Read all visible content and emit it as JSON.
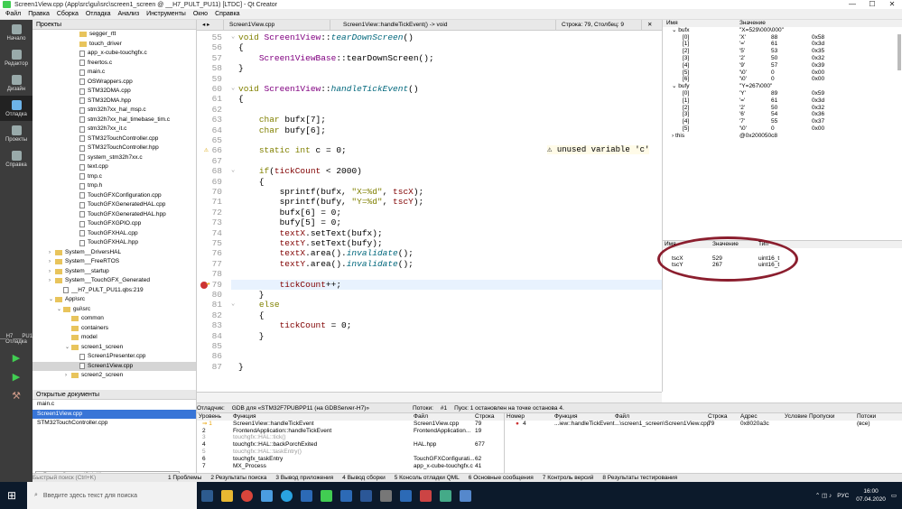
{
  "window": {
    "title": "Screen1View.cpp (App\\src\\gui\\src\\screen1_screen @ __H7_PULT_PU11) [LTDC] - Qt Creator",
    "controls": [
      "—",
      "☐",
      "✕"
    ]
  },
  "menu": [
    "Файл",
    "Правка",
    "Сборка",
    "Отладка",
    "Анализ",
    "Инструменты",
    "Окно",
    "Справка"
  ],
  "modes": [
    {
      "label": "Начало",
      "icon": "grid-icon"
    },
    {
      "label": "Редактор",
      "icon": "document-icon"
    },
    {
      "label": "Дизайн",
      "icon": "pencil-icon"
    },
    {
      "label": "Отладка",
      "icon": "bug-icon"
    },
    {
      "label": "Проекты",
      "icon": "wrench-icon"
    },
    {
      "label": "Справка",
      "icon": "help-icon"
    }
  ],
  "mode_kit": "__H7___PU11",
  "mode_kit2": "Отладка",
  "project": {
    "header": "Проекты",
    "items": [
      {
        "t": "segger_rtt",
        "k": "fo",
        "d": 5
      },
      {
        "t": "touch_driver",
        "k": "fo",
        "d": 5
      },
      {
        "t": "app_x-cube-touchgfx.c",
        "k": "fi",
        "d": 5
      },
      {
        "t": "freertos.c",
        "k": "fi",
        "d": 5
      },
      {
        "t": "main.c",
        "k": "fi",
        "d": 5
      },
      {
        "t": "OSWrappers.cpp",
        "k": "fi",
        "d": 5
      },
      {
        "t": "STM32DMA.cpp",
        "k": "fi",
        "d": 5
      },
      {
        "t": "STM32DMA.hpp",
        "k": "fi",
        "d": 5
      },
      {
        "t": "stm32h7xx_hal_msp.c",
        "k": "fi",
        "d": 5
      },
      {
        "t": "stm32h7xx_hal_timebase_tim.c",
        "k": "fi",
        "d": 5
      },
      {
        "t": "stm32h7xx_it.c",
        "k": "fi",
        "d": 5
      },
      {
        "t": "STM32TouchController.cpp",
        "k": "fi",
        "d": 5
      },
      {
        "t": "STM32TouchController.hpp",
        "k": "fi",
        "d": 5
      },
      {
        "t": "system_stm32h7xx.c",
        "k": "fi",
        "d": 5
      },
      {
        "t": "text.cpp",
        "k": "fi",
        "d": 5
      },
      {
        "t": "tmp.c",
        "k": "fi",
        "d": 5
      },
      {
        "t": "tmp.h",
        "k": "fi",
        "d": 5
      },
      {
        "t": "TouchGFXConfiguration.cpp",
        "k": "fi",
        "d": 5
      },
      {
        "t": "TouchGFXGeneratedHAL.cpp",
        "k": "fi",
        "d": 5
      },
      {
        "t": "TouchGFXGeneratedHAL.hpp",
        "k": "fi",
        "d": 5
      },
      {
        "t": "TouchGFXGPIO.cpp",
        "k": "fi",
        "d": 5
      },
      {
        "t": "TouchGFXHAL.cpp",
        "k": "fi",
        "d": 5
      },
      {
        "t": "TouchGFXHAL.hpp",
        "k": "fi",
        "d": 5
      },
      {
        "t": "System__DriversHAL",
        "k": "fo",
        "d": 2,
        "a": "›"
      },
      {
        "t": "System__FreeRTOS",
        "k": "fo",
        "d": 2,
        "a": "›"
      },
      {
        "t": "System__startup",
        "k": "fo",
        "d": 2,
        "a": "›"
      },
      {
        "t": "System__TouchGFX_Generated",
        "k": "fo",
        "d": 2,
        "a": "›"
      },
      {
        "t": "__H7_PULT_PU11.qbs:219",
        "k": "fi",
        "d": 3
      },
      {
        "t": "App\\src",
        "k": "fo",
        "d": 2,
        "a": "⌄"
      },
      {
        "t": "gui\\src",
        "k": "fo",
        "d": 3,
        "a": "⌄"
      },
      {
        "t": "common",
        "k": "fo",
        "d": 4
      },
      {
        "t": "containers",
        "k": "fo",
        "d": 4
      },
      {
        "t": "model",
        "k": "fo",
        "d": 4
      },
      {
        "t": "screen1_screen",
        "k": "fo",
        "d": 4,
        "a": "⌄"
      },
      {
        "t": "Screen1Presenter.cpp",
        "k": "fi",
        "d": 5
      },
      {
        "t": "Screen1View.cpp",
        "k": "fi",
        "d": 5,
        "sel": true
      },
      {
        "t": "screen2_screen",
        "k": "fo",
        "d": 4,
        "a": "›"
      }
    ]
  },
  "open_docs": {
    "header": "Открытые документы",
    "items": [
      "main.c",
      "Screen1View.cpp",
      "STM32TouchController.cpp"
    ],
    "selected": 1
  },
  "editor": {
    "file": "Screen1View.cpp",
    "symbol": "Screen1View::handleTickEvent() -> void",
    "position": "Строка: 79, Столбец: 9",
    "lines": [
      {
        "n": "55",
        "h": "<span class=\"kw\">void</span> <span class=\"cls\">Screen1View</span>::<span class=\"fn\">tearDownScreen</span>()"
      },
      {
        "n": "56",
        "h": "{"
      },
      {
        "n": "57",
        "h": "    <span class=\"cls\">Screen1ViewBase</span>::tearDownScreen();"
      },
      {
        "n": "58",
        "h": "}"
      },
      {
        "n": "59",
        "h": ""
      },
      {
        "n": "60",
        "h": "<span class=\"kw\">void</span> <span class=\"cls\">Screen1View</span>::<span class=\"fn\">handleTickEvent</span>()"
      },
      {
        "n": "61",
        "h": "{"
      },
      {
        "n": "62",
        "h": ""
      },
      {
        "n": "63",
        "h": "    <span class=\"kw\">char</span> bufx[7];"
      },
      {
        "n": "64",
        "h": "    <span class=\"kw\">char</span> bufy[6];"
      },
      {
        "n": "65",
        "h": ""
      },
      {
        "n": "66",
        "h": "    <span class=\"kw\">static</span> <span class=\"kw\">int</span> c = 0;"
      },
      {
        "n": "67",
        "h": ""
      },
      {
        "n": "68",
        "h": "    <span class=\"kw\">if</span>(<span class=\"mm\">tickCount</span> &lt; 2000)"
      },
      {
        "n": "69",
        "h": "    {"
      },
      {
        "n": "70",
        "h": "        sprintf(bufx, <span class=\"kw\">\"X=%d\"</span>, <span class=\"mm\">tscX</span>);"
      },
      {
        "n": "71",
        "h": "        sprintf(bufy, <span class=\"kw\">\"Y=%d\"</span>, <span class=\"mm\">tscY</span>);"
      },
      {
        "n": "72",
        "h": "        bufx[6] = 0;"
      },
      {
        "n": "73",
        "h": "        bufy[5] = 0;"
      },
      {
        "n": "74",
        "h": "        <span class=\"mm\">textX</span>.setText(bufx);"
      },
      {
        "n": "75",
        "h": "        <span class=\"mm\">textY</span>.setText(bufy);"
      },
      {
        "n": "76",
        "h": "        <span class=\"mm\">textX</span>.area().<span class=\"fn\">invalidate</span>();"
      },
      {
        "n": "77",
        "h": "        <span class=\"mm\">textY</span>.area().<span class=\"fn\">invalidate</span>();"
      },
      {
        "n": "78",
        "h": ""
      },
      {
        "n": "79",
        "h": "        <span class=\"mm\">tickCount</span>++;"
      },
      {
        "n": "80",
        "h": "    }"
      },
      {
        "n": "81",
        "h": "    <span class=\"kw\">else</span>"
      },
      {
        "n": "82",
        "h": "    {"
      },
      {
        "n": "83",
        "h": "        <span class=\"mm\">tickCount</span> = 0;"
      },
      {
        "n": "84",
        "h": "    }"
      },
      {
        "n": "85",
        "h": ""
      },
      {
        "n": "86",
        "h": ""
      },
      {
        "n": "87",
        "h": "}"
      }
    ],
    "warning": "⚠ unused variable 'c'",
    "warning_line": "66",
    "current_line": "79"
  },
  "watch": {
    "headers": [
      "Имя",
      "Значение"
    ],
    "rows": [
      {
        "i": 0,
        "n": "⌄ bufx",
        "v": "\"X=529\\000\\000\"",
        "h": ""
      },
      {
        "i": 1,
        "n": "[0]",
        "v": "'X'",
        "d": "88",
        "h": "0x58"
      },
      {
        "i": 1,
        "n": "[1]",
        "v": "'='",
        "d": "61",
        "h": "0x3d"
      },
      {
        "i": 1,
        "n": "[2]",
        "v": "'5'",
        "d": "53",
        "h": "0x35"
      },
      {
        "i": 1,
        "n": "[3]",
        "v": "'2'",
        "d": "50",
        "h": "0x32"
      },
      {
        "i": 1,
        "n": "[4]",
        "v": "'9'",
        "d": "57",
        "h": "0x39"
      },
      {
        "i": 1,
        "n": "[5]",
        "v": "'\\0'",
        "d": "0",
        "h": "0x00"
      },
      {
        "i": 1,
        "n": "[6]",
        "v": "'\\0'",
        "d": "0",
        "h": "0x00"
      },
      {
        "i": 0,
        "n": "⌄ bufy",
        "v": "\"Y=267\\000\"",
        "h": ""
      },
      {
        "i": 1,
        "n": "[0]",
        "v": "'Y'",
        "d": "89",
        "h": "0x59"
      },
      {
        "i": 1,
        "n": "[1]",
        "v": "'='",
        "d": "61",
        "h": "0x3d"
      },
      {
        "i": 1,
        "n": "[2]",
        "v": "'2'",
        "d": "50",
        "h": "0x32"
      },
      {
        "i": 1,
        "n": "[3]",
        "v": "'6'",
        "d": "54",
        "h": "0x36"
      },
      {
        "i": 1,
        "n": "[4]",
        "v": "'7'",
        "d": "55",
        "h": "0x37"
      },
      {
        "i": 1,
        "n": "[5]",
        "v": "'\\0'",
        "d": "0",
        "h": "0x00"
      },
      {
        "i": 0,
        "n": "› this",
        "v": "@0x200050c8",
        "h": ""
      }
    ]
  },
  "locals": {
    "headers": [
      "Имя",
      "Значение",
      "Тип"
    ],
    "rows": [
      {
        "n": "tscX",
        "v": "529",
        "t": "uint16_t"
      },
      {
        "n": "tscY",
        "v": "267",
        "t": "uint16_t"
      }
    ]
  },
  "debugbar": [
    "Отладчик:",
    "GDB для «STM32F7PUBPP11 (на GDBServer-H7)»",
    "Потоки:",
    "#1",
    "Пуск: 1 остановлен на точке останова 4."
  ],
  "stack": {
    "headers": [
      "Уровень",
      "Функция",
      "Файл",
      "Строка"
    ],
    "rows": [
      {
        "l": "⇒ 1",
        "f": "Screen1View::handleTickEvent",
        "file": "Screen1View.cpp",
        "line": "79",
        "g": false
      },
      {
        "l": "2",
        "f": "FrontendApplication::handleTickEvent",
        "file": "FrontendApplication...",
        "line": "19",
        "g": false
      },
      {
        "l": "3",
        "f": "touchgfx::HAL::tick()",
        "file": "",
        "line": "",
        "g": true
      },
      {
        "l": "4",
        "f": "touchgfx::HAL::backPorchExited",
        "file": "HAL.hpp",
        "line": "677",
        "g": false
      },
      {
        "l": "5",
        "f": "touchgfx::HAL::taskEntry()",
        "file": "",
        "line": "",
        "g": true
      },
      {
        "l": "6",
        "f": "touchgfx_taskEntry",
        "file": "TouchGFXConfigurati...",
        "line": "62",
        "g": false
      },
      {
        "l": "7",
        "f": "MX_Process",
        "file": "app_x-cube-touchgfx.c",
        "line": "41",
        "g": false
      }
    ]
  },
  "breakpoints": {
    "headers": [
      "Номер",
      "Функция",
      "Файл",
      "Строка",
      "Адрес",
      "Условие",
      "Пропуски",
      "Потоки"
    ],
    "rows": [
      {
        "num": "4",
        "fn": "...iew::handleTickEvent",
        "file": "...\\screen1_screen\\Screen1View.cpp",
        "line": "79",
        "addr": "0x8020a3c",
        "th": "(все)"
      }
    ]
  },
  "output_tabs": [
    "1 Проблемы",
    "2 Результаты поиска",
    "3 Вывод приложения",
    "4 Вывод сборки",
    "5 Консоль отладки QML",
    "6 Основные сообщения",
    "7 Контроль версий",
    "8 Результаты тестирования"
  ],
  "locate": "Быстрый поиск (Ctrl+K)",
  "taskbar": {
    "search": "Введите здесь текст для поиска",
    "lang": "РУС",
    "time": "16:00",
    "date": "07.04.2020"
  },
  "colors": {
    "accent": "#3875d7",
    "mode_bg": "#3c3c3c",
    "taskbar": "#0c1a2b",
    "ellipse": "#8b1e2e"
  }
}
